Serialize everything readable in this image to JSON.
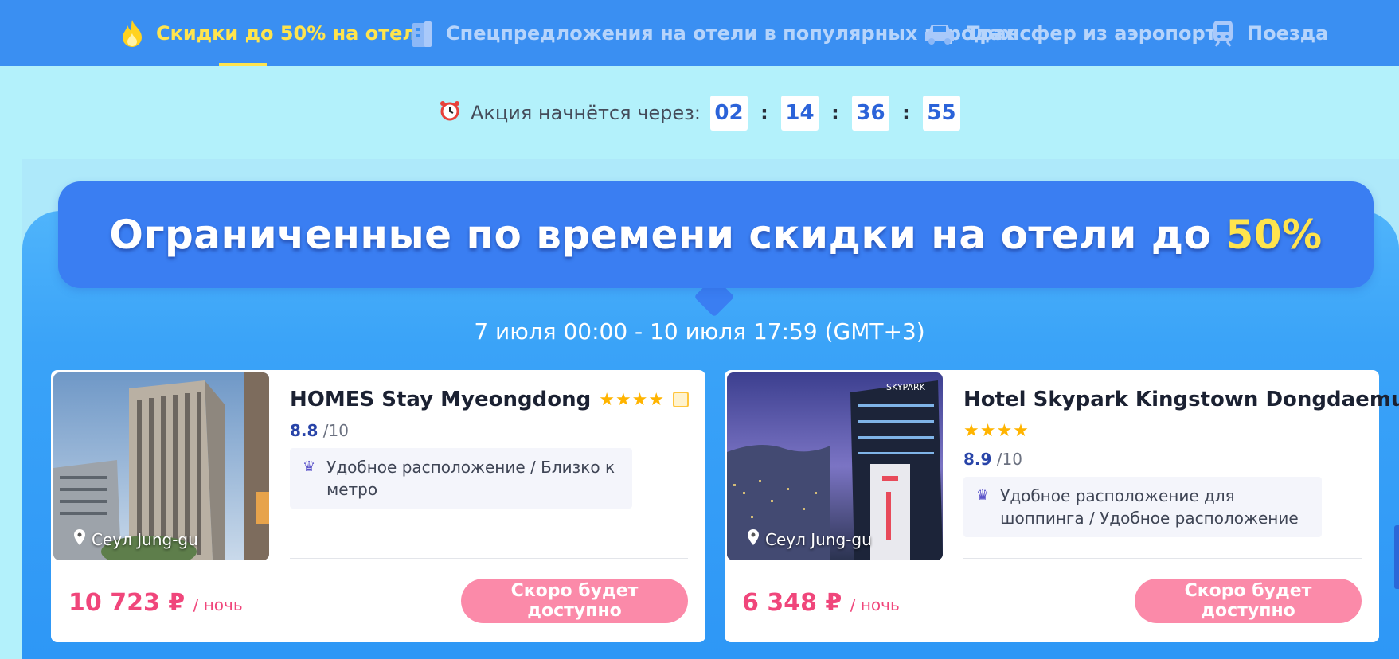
{
  "nav": {
    "items": [
      {
        "label": "Скидки до 50% на отели",
        "icon": "fire-icon",
        "active": true
      },
      {
        "label": "Спецпредложения на отели в популярных городах",
        "icon": "building-icon",
        "active": false
      },
      {
        "label": "Трансфер из аэропорта",
        "icon": "car-icon",
        "active": false
      },
      {
        "label": "Поезда",
        "icon": "train-icon",
        "active": false
      }
    ]
  },
  "countdown": {
    "label": "Акция начнётся через:",
    "icon": "alarm-clock-icon",
    "days": "02",
    "hours": "14",
    "minutes": "36",
    "seconds": "55",
    "separator": ":"
  },
  "banner": {
    "title_main": "Ограниченные по времени скидки на отели до ",
    "title_highlight": "50%",
    "period": "7 июля 00:00 - 10 июля 17:59 (GMT+3)"
  },
  "hotels": [
    {
      "name": "HOMES Stay Myeongdong",
      "stars": "★★★★",
      "rating": "8.8",
      "rating_max": "/10",
      "feature": "Удобное расположение / Близко к метро",
      "location": "Сеул Jung-gu",
      "price": "10 723 ₽",
      "price_unit": "/ ночь",
      "button": "Скоро будет доступно"
    },
    {
      "name": "Hotel Skypark Kingstown Dongdaemun",
      "stars": "★★★★",
      "rating": "8.9",
      "rating_max": "/10",
      "feature": "Удобное расположение для шоппинга / Удобное расположение",
      "location": "Сеул Jung-gu",
      "price": "6 348 ₽",
      "price_unit": "/ ночь",
      "button": "Скоро будет доступно"
    }
  ],
  "colors": {
    "nav_bg": "#3a8ff2",
    "active": "#ffe44d",
    "price": "#f0467b",
    "button": "#fb8aa9",
    "banner": "#3a7ef2"
  }
}
